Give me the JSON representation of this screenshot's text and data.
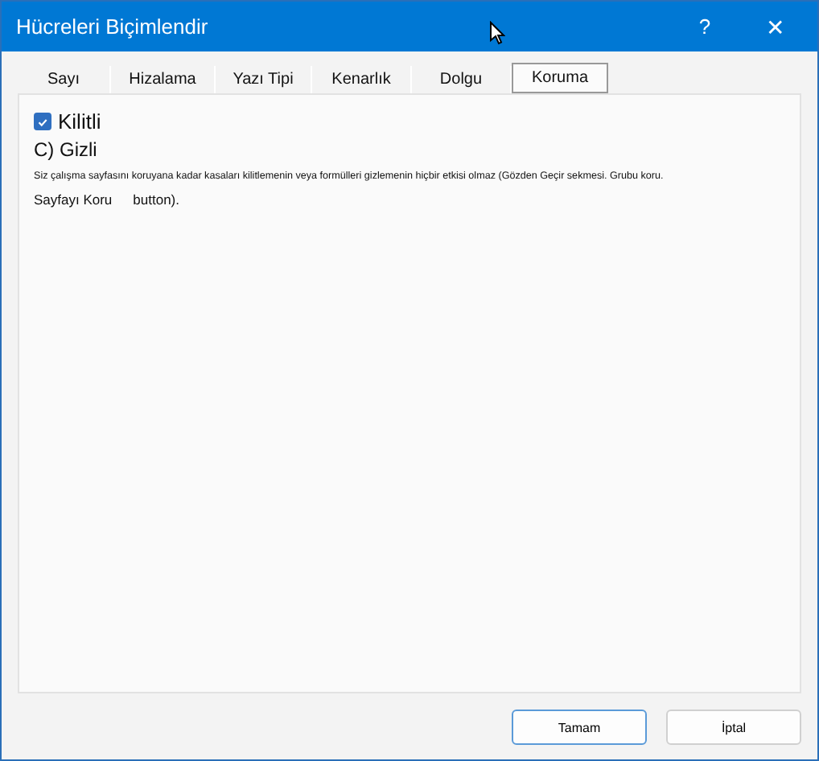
{
  "window": {
    "title": "Hücreleri Biçimlendir",
    "help": "?",
    "close": "✕"
  },
  "tabs": [
    {
      "label": "Sayı",
      "selected": false
    },
    {
      "label": "Hizalama",
      "selected": false
    },
    {
      "label": "Yazı Tipi",
      "selected": false
    },
    {
      "label": "Kenarlık",
      "selected": false
    },
    {
      "label": "Dolgu",
      "selected": false
    },
    {
      "label": "Koruma",
      "selected": true
    }
  ],
  "locked": {
    "label": "Kilitli",
    "checked": true
  },
  "hidden": {
    "label": "C) Gizli"
  },
  "note": "Siz çalışma sayfasını koruyana kadar kasaları kilitlemenin veya formülleri gizlemenin hiçbir etkisi olmaz (Gözden Geçir sekmesi. Grubu koru.",
  "note_line2": [
    "Sayfayı Koru",
    "button)."
  ],
  "buttons": [
    {
      "label": "Tamam",
      "kind": "primary"
    },
    {
      "label": "İptal",
      "kind": "normal"
    }
  ]
}
